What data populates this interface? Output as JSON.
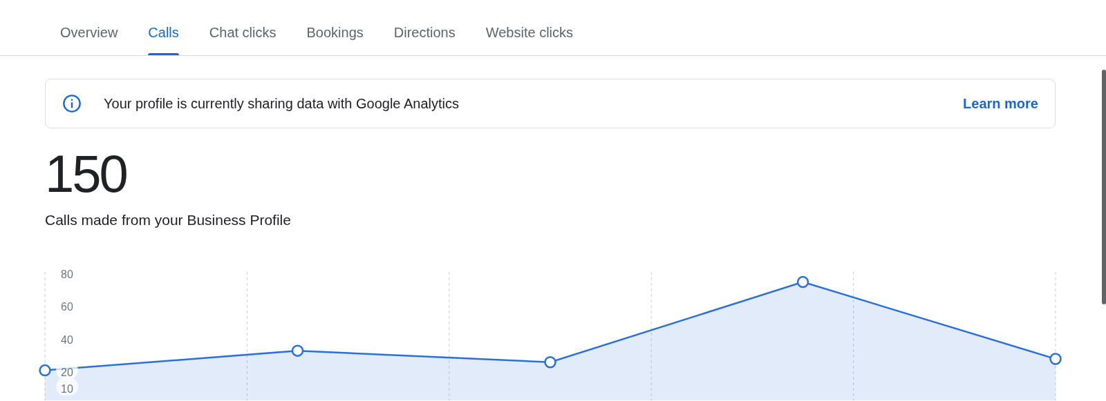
{
  "tabs": [
    {
      "label": "Overview",
      "selected": false
    },
    {
      "label": "Calls",
      "selected": true
    },
    {
      "label": "Chat clicks",
      "selected": false
    },
    {
      "label": "Bookings",
      "selected": false
    },
    {
      "label": "Directions",
      "selected": false
    },
    {
      "label": "Website clicks",
      "selected": false
    }
  ],
  "banner": {
    "message": "Your profile is currently sharing data with Google Analytics",
    "link": "Learn more"
  },
  "summary": {
    "total": "150",
    "caption": "Calls made from your Business Profile"
  },
  "chart": {
    "chart_data": {
      "type": "area",
      "categories": [
        null,
        null,
        null,
        null,
        null
      ],
      "ylim": [
        0,
        80
      ],
      "yticks": [
        10,
        20,
        40,
        60,
        80
      ],
      "series": [
        {
          "color": "#2a6fdb",
          "values": [
            20,
            32,
            25,
            74,
            27
          ]
        }
      ]
    }
  }
}
